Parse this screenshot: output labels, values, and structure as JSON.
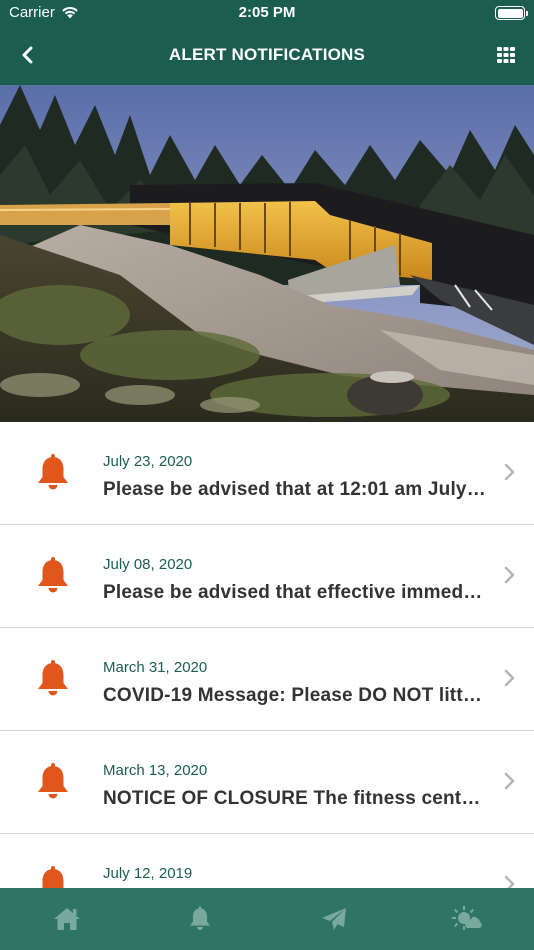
{
  "status_bar": {
    "carrier": "Carrier",
    "time": "2:05 PM"
  },
  "nav": {
    "title": "ALERT NOTIFICATIONS"
  },
  "alerts": [
    {
      "date": "July 23, 2020",
      "message": "Please be advised that at 12:01 am July …"
    },
    {
      "date": "July 08, 2020",
      "message": "Please be advised that effective immed…"
    },
    {
      "date": "March 31, 2020",
      "message": "COVID-19 Message: Please DO NOT litt…"
    },
    {
      "date": "March 13, 2020",
      "message": "NOTICE OF CLOSURE The fitness centre…"
    },
    {
      "date": "July 12, 2019",
      "message": ""
    }
  ],
  "tabs": [
    {
      "icon": "home-icon"
    },
    {
      "icon": "bell-icon"
    },
    {
      "icon": "paper-plane-icon"
    },
    {
      "icon": "weather-icon"
    }
  ],
  "colors": {
    "primary": "#1b5e4f",
    "tab_bar": "#2e7566",
    "bell": "#e0561b",
    "tab_icon": "#79a99c"
  }
}
